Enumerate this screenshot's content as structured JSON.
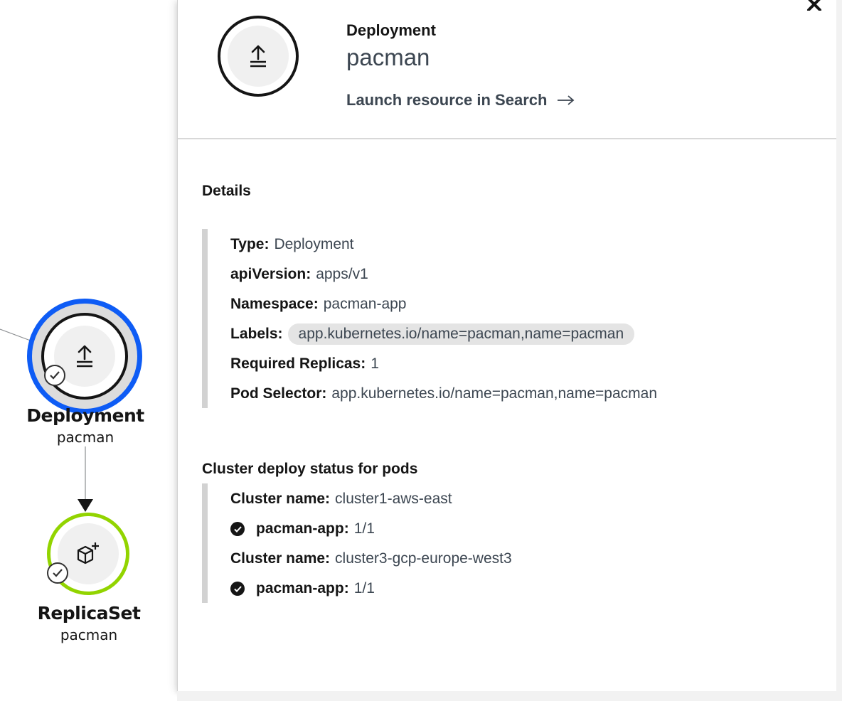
{
  "topology": {
    "deployment_node": {
      "kind": "Deployment",
      "name": "pacman",
      "icon": "upload-icon",
      "status_icon": "check-circle-icon"
    },
    "replicaset_node": {
      "kind": "ReplicaSet",
      "name": "pacman",
      "icon": "cube-plus-icon",
      "status_icon": "check-circle-icon"
    }
  },
  "panel": {
    "header": {
      "kind": "Deployment",
      "name": "pacman",
      "link_label": "Launch resource in Search",
      "icon": "upload-icon"
    },
    "details": {
      "title": "Details",
      "rows": [
        {
          "key": "Type:",
          "value": "Deployment"
        },
        {
          "key": "apiVersion:",
          "value": "apps/v1"
        },
        {
          "key": "Namespace:",
          "value": "pacman-app"
        },
        {
          "key": "Labels:",
          "value": "app.kubernetes.io/name=pacman,name=pacman"
        },
        {
          "key": "Required Replicas:",
          "value": "1"
        },
        {
          "key": "Pod Selector:",
          "value": "app.kubernetes.io/name=pacman,name=pacman"
        }
      ]
    },
    "cluster_status": {
      "title": "Cluster deploy status for pods",
      "clusters": [
        {
          "label": "Cluster name:",
          "name": "cluster1-aws-east",
          "pod_label": "pacman-app:",
          "pod_status": "1/1"
        },
        {
          "label": "Cluster name:",
          "name": "cluster3-gcp-europe-west3",
          "pod_label": "pacman-app:",
          "pod_status": "1/1"
        }
      ]
    }
  },
  "colors": {
    "selected_ring": "#0e5cf5",
    "replicaset_ring": "#92d400",
    "text_secondary": "#3c4651"
  }
}
